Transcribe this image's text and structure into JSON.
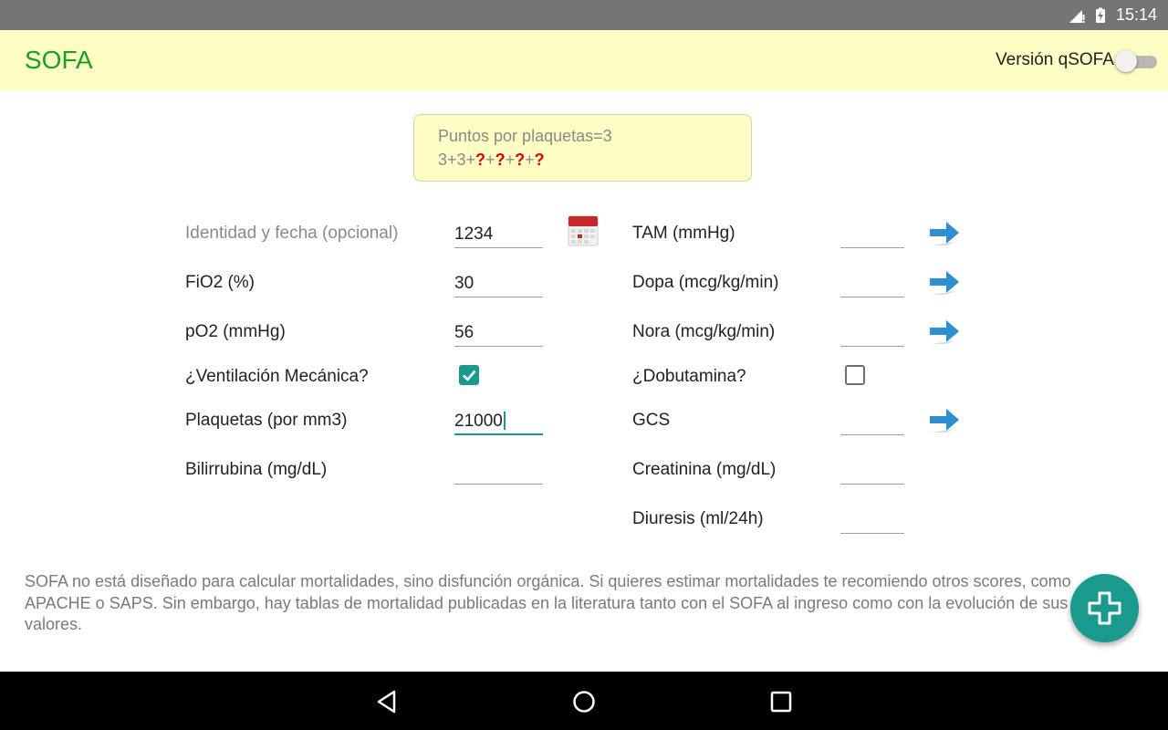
{
  "status_bar": {
    "time": "15:14"
  },
  "app_bar": {
    "title": "SOFA",
    "qsofa_label": "Versión qSOFA",
    "qsofa_enabled": false
  },
  "result": {
    "line1": "Puntos por plaquetas=3",
    "line2_parts": [
      "3+3+",
      "?",
      "+",
      "?",
      "+",
      "?",
      "+",
      "?"
    ]
  },
  "left_fields": [
    {
      "label": "Identidad y fecha (opcional)",
      "value": "1234"
    },
    {
      "label": "FiO2 (%)",
      "value": "30"
    },
    {
      "label": "pO2 (mmHg)",
      "value": "56"
    },
    {
      "label": "¿Ventilación Mecánica?",
      "checked": true
    },
    {
      "label": "Plaquetas (por mm3)",
      "value": "21000"
    },
    {
      "label": "Bilirrubina (mg/dL)",
      "value": ""
    }
  ],
  "right_fields": [
    {
      "label": "TAM (mmHg)",
      "value": ""
    },
    {
      "label": "Dopa (mcg/kg/min)",
      "value": ""
    },
    {
      "label": "Nora (mcg/kg/min)",
      "value": ""
    },
    {
      "label": "¿Dobutamina?",
      "checked": false
    },
    {
      "label": "GCS",
      "value": ""
    },
    {
      "label": "Creatinina (mg/dL)",
      "value": ""
    },
    {
      "label": "Diuresis (ml/24h)",
      "value": ""
    }
  ],
  "footnote": "SOFA no está diseñado para calcular mortalidades, sino disfunción orgánica. Si quieres estimar mortalidades te recomiendo otros scores, como APACHE o SAPS. Sin embargo, hay tablas de mortalidad publicadas en la literatura tanto con el SOFA al ingreso como con la evolución de sus valores.",
  "colors": {
    "accent": "#1a9a8c",
    "title_green": "#1aa020",
    "appbar_bg": "#fdfdc4",
    "question_red": "#e00000"
  },
  "icons": {
    "calendar": "calendar-icon",
    "arrow": "arrow-right-icon",
    "fab": "plus-icon",
    "nav_back": "back-triangle-icon",
    "nav_home": "home-circle-icon",
    "nav_recents": "recents-square-icon"
  }
}
